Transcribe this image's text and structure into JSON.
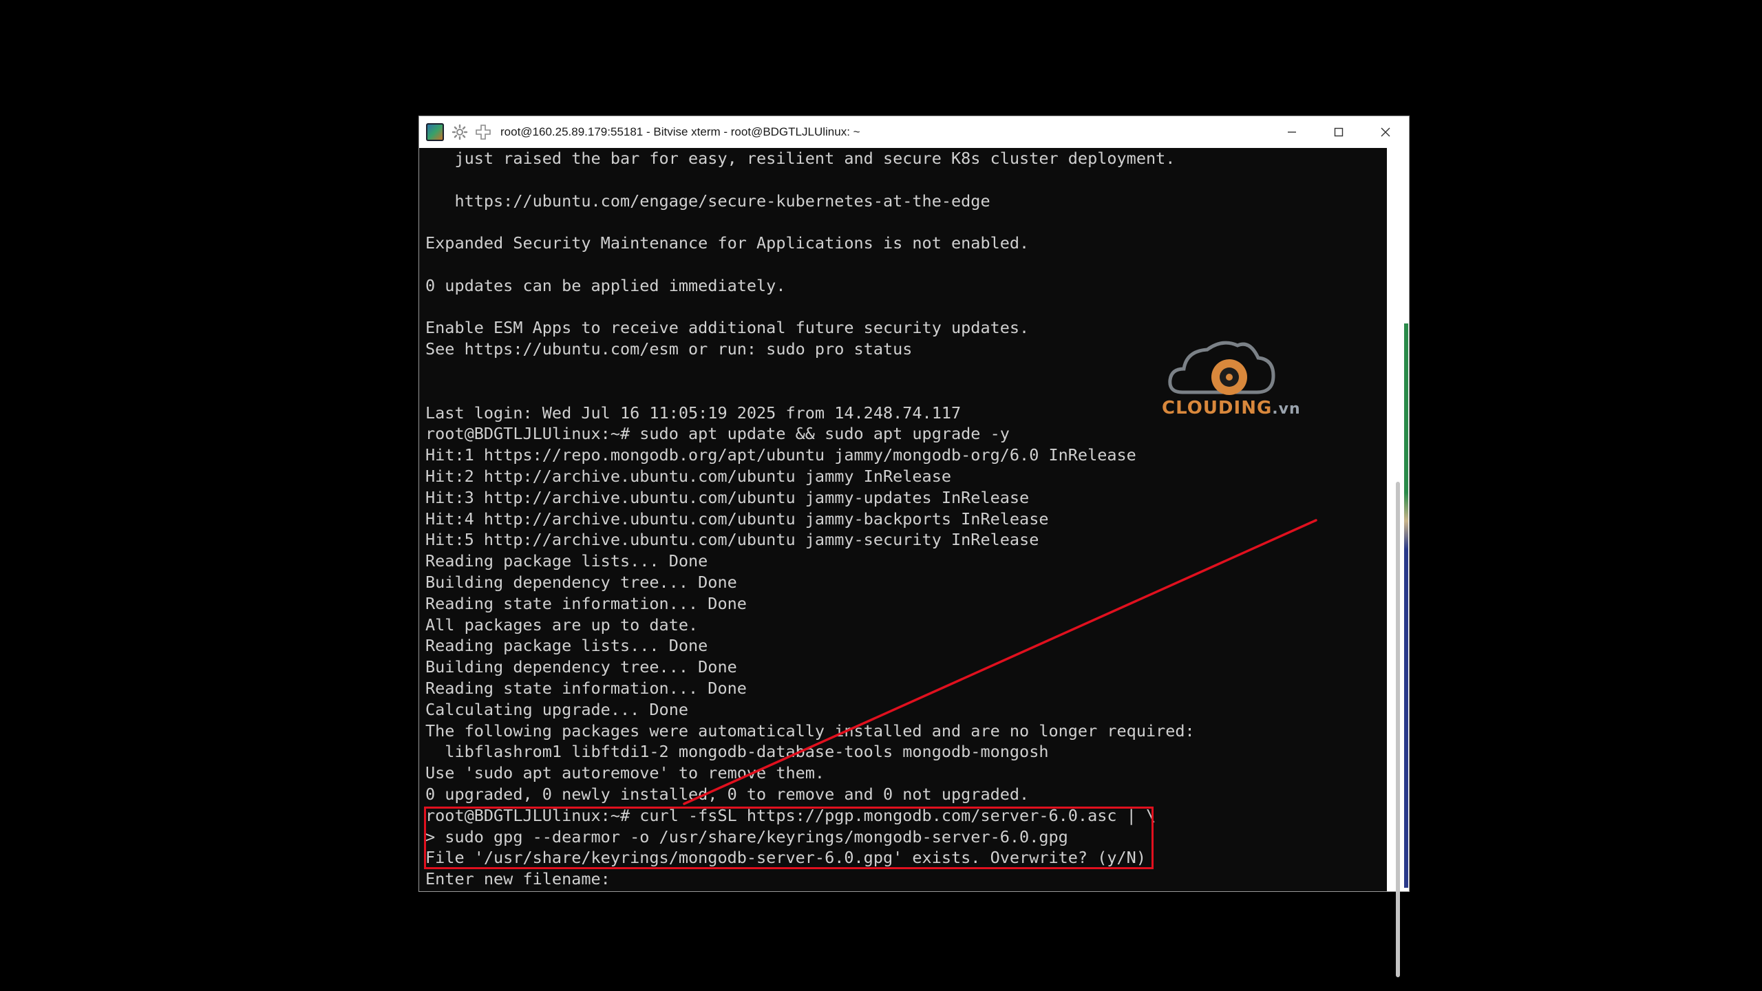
{
  "window": {
    "title": "root@160.25.89.179:55181 - Bitvise xterm - root@BDGTLJLUlinux: ~",
    "icons": [
      "bitvise-app-icon",
      "settings-gear-icon",
      "new-terminal-plus-icon"
    ]
  },
  "terminal": {
    "lines": [
      "   just raised the bar for easy, resilient and secure K8s cluster deployment.",
      "",
      "   https://ubuntu.com/engage/secure-kubernetes-at-the-edge",
      "",
      "Expanded Security Maintenance for Applications is not enabled.",
      "",
      "0 updates can be applied immediately.",
      "",
      "Enable ESM Apps to receive additional future security updates.",
      "See https://ubuntu.com/esm or run: sudo pro status",
      "",
      "",
      "Last login: Wed Jul 16 11:05:19 2025 from 14.248.74.117",
      "root@BDGTLJLUlinux:~# sudo apt update && sudo apt upgrade -y",
      "Hit:1 https://repo.mongodb.org/apt/ubuntu jammy/mongodb-org/6.0 InRelease",
      "Hit:2 http://archive.ubuntu.com/ubuntu jammy InRelease",
      "Hit:3 http://archive.ubuntu.com/ubuntu jammy-updates InRelease",
      "Hit:4 http://archive.ubuntu.com/ubuntu jammy-backports InRelease",
      "Hit:5 http://archive.ubuntu.com/ubuntu jammy-security InRelease",
      "Reading package lists... Done",
      "Building dependency tree... Done",
      "Reading state information... Done",
      "All packages are up to date.",
      "Reading package lists... Done",
      "Building dependency tree... Done",
      "Reading state information... Done",
      "Calculating upgrade... Done",
      "The following packages were automatically installed and are no longer required:",
      "  libflashrom1 libftdi1-2 mongodb-database-tools mongodb-mongosh",
      "Use 'sudo apt autoremove' to remove them.",
      "0 upgraded, 0 newly installed, 0 to remove and 0 not upgraded.",
      "root@BDGTLJLUlinux:~# curl -fsSL https://pgp.mongodb.com/server-6.0.asc | \\",
      "> sudo gpg --dearmor -o /usr/share/keyrings/mongodb-server-6.0.gpg",
      "File '/usr/share/keyrings/mongodb-server-6.0.gpg' exists. Overwrite? (y/N)",
      "Enter new filename: "
    ]
  },
  "watermark": {
    "brand": "CLOUDING",
    "suffix": ".vn"
  },
  "colors": {
    "terminal_bg": "#0c0c0c",
    "terminal_fg": "#d0d0d0",
    "annotation_red": "#e0101e",
    "watermark_orange": "#d9883c"
  }
}
